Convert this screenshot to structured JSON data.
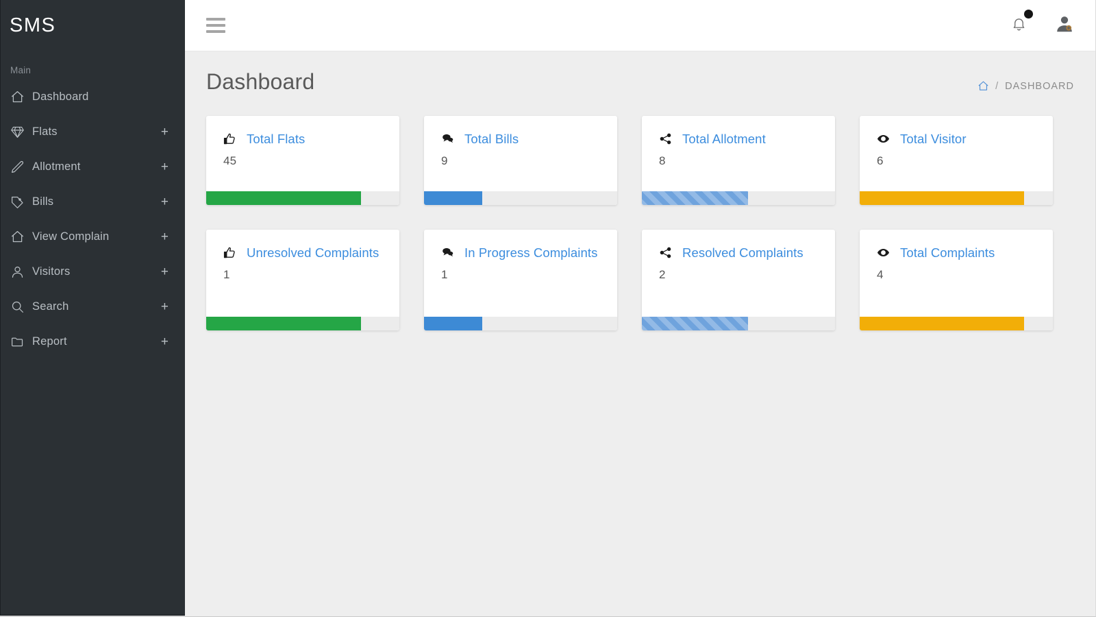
{
  "sidebar": {
    "brand": "SMS",
    "section_label": "Main",
    "items": [
      {
        "label": "Dashboard",
        "icon": "home-icon",
        "expandable": false,
        "expand_label": ""
      },
      {
        "label": "Flats",
        "icon": "diamond-icon",
        "expandable": true,
        "expand_label": "+"
      },
      {
        "label": "Allotment",
        "icon": "pencil-icon",
        "expandable": true,
        "expand_label": "+"
      },
      {
        "label": "Bills",
        "icon": "tag-icon",
        "expandable": true,
        "expand_label": "+"
      },
      {
        "label": "View Complain",
        "icon": "home-icon",
        "expandable": true,
        "expand_label": "+"
      },
      {
        "label": "Visitors",
        "icon": "user-icon",
        "expandable": true,
        "expand_label": "+"
      },
      {
        "label": "Search",
        "icon": "search-icon",
        "expandable": true,
        "expand_label": "+"
      },
      {
        "label": "Report",
        "icon": "folder-icon",
        "expandable": true,
        "expand_label": "+"
      }
    ]
  },
  "topbar": {
    "menu_toggle_icon": "hamburger-icon",
    "notification_icon": "bell-icon",
    "notification_badge": true,
    "profile_icon": "user-avatar-icon"
  },
  "page": {
    "title": "Dashboard",
    "breadcrumb": {
      "home_icon": "home-icon",
      "separator": "/",
      "current": "DASHBOARD"
    }
  },
  "colors": {
    "accent_blue": "#3c8dde",
    "sidebar_bg": "#2b3034",
    "page_bg": "#eeeeee",
    "green": "#25a646",
    "blue": "#3d8ad5",
    "amber": "#f2ae08",
    "striped_blue": "#6fa3dd"
  },
  "cards": [
    {
      "title": "Total Flats",
      "value": "45",
      "icon": "thumbs-up-icon",
      "bar_style": "solid",
      "bar_color": "green",
      "bar_percent": 80,
      "two_line": false
    },
    {
      "title": "Total Bills",
      "value": "9",
      "icon": "comments-icon",
      "bar_style": "solid",
      "bar_color": "blue",
      "bar_percent": 30,
      "two_line": false
    },
    {
      "title": "Total Allotment",
      "value": "8",
      "icon": "share-icon",
      "bar_style": "striped",
      "bar_color": "striped_blue",
      "bar_percent": 55,
      "two_line": false
    },
    {
      "title": "Total Visitor",
      "value": "6",
      "icon": "eye-icon",
      "bar_style": "solid",
      "bar_color": "amber",
      "bar_percent": 85,
      "two_line": false
    },
    {
      "title": "Unresolved Complaints",
      "value": "1",
      "icon": "thumbs-up-icon",
      "bar_style": "solid",
      "bar_color": "green",
      "bar_percent": 80,
      "two_line": true
    },
    {
      "title": "In Progress Complaints",
      "value": "1",
      "icon": "comments-icon",
      "bar_style": "solid",
      "bar_color": "blue",
      "bar_percent": 30,
      "two_line": true
    },
    {
      "title": "Resolved Complaints",
      "value": "2",
      "icon": "share-icon",
      "bar_style": "striped",
      "bar_color": "striped_blue",
      "bar_percent": 55,
      "two_line": false
    },
    {
      "title": "Total Complaints",
      "value": "4",
      "icon": "eye-icon",
      "bar_style": "solid",
      "bar_color": "amber",
      "bar_percent": 85,
      "two_line": false
    }
  ]
}
